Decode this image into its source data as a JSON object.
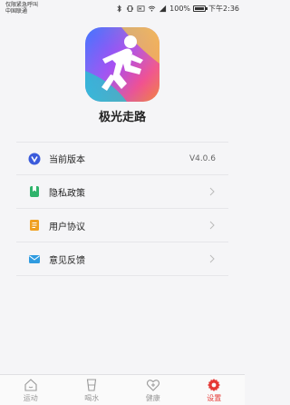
{
  "status_bar": {
    "carrier_line1": "仅限紧急呼叫",
    "carrier_line2": "中国联通",
    "battery_text": "100%",
    "time": "下午2:36",
    "battery_level": 1.0
  },
  "app": {
    "name": "极光走路"
  },
  "list": {
    "items": [
      {
        "label": "当前版本",
        "value": "V4.0.6",
        "icon": "version-icon"
      },
      {
        "label": "隐私政策",
        "icon": "privacy-icon"
      },
      {
        "label": "用户协议",
        "icon": "agreement-icon"
      },
      {
        "label": "意见反馈",
        "icon": "feedback-icon"
      }
    ]
  },
  "tabs": [
    {
      "label": "运动",
      "icon": "home-icon"
    },
    {
      "label": "喝水",
      "icon": "cup-icon"
    },
    {
      "label": "健康",
      "icon": "heart-plus-icon"
    },
    {
      "label": "设置",
      "icon": "gear-icon",
      "active": true
    }
  ],
  "colors": {
    "accent": "#e53935",
    "version_icon": "#3b5bdb",
    "privacy_icon": "#2fb36b",
    "agreement_icon": "#f0a020",
    "feedback_icon": "#2f9be0"
  }
}
